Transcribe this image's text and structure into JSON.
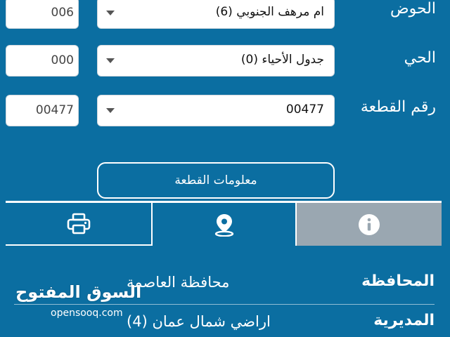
{
  "fields": {
    "basin": {
      "label": "الحوض",
      "selected": "ام مرهف الجنوبي (6)",
      "code": "006"
    },
    "district": {
      "label": "الحي",
      "selected": "جدول الأحياء (0)",
      "code": "000"
    },
    "plot": {
      "label": "رقم القطعة",
      "selected": "00477",
      "code": "00477"
    }
  },
  "info_button": {
    "label": "معلومات القطعة"
  },
  "tabs": {
    "print": {
      "icon": "printer-icon"
    },
    "location": {
      "icon": "map-pin-icon"
    },
    "info": {
      "icon": "info-icon",
      "active": true
    }
  },
  "details": [
    {
      "key": "المحافظة",
      "value": "محافظة العاصمة"
    },
    {
      "key": "المديرية",
      "value": "اراضي شمال عمان (4)"
    }
  ],
  "watermark": {
    "brand": "السوق المفتوح",
    "site": "opensooq.com"
  },
  "colors": {
    "background": "#0b6ea1",
    "active_tab": "#9aa7b1",
    "text": "#ffffff"
  }
}
